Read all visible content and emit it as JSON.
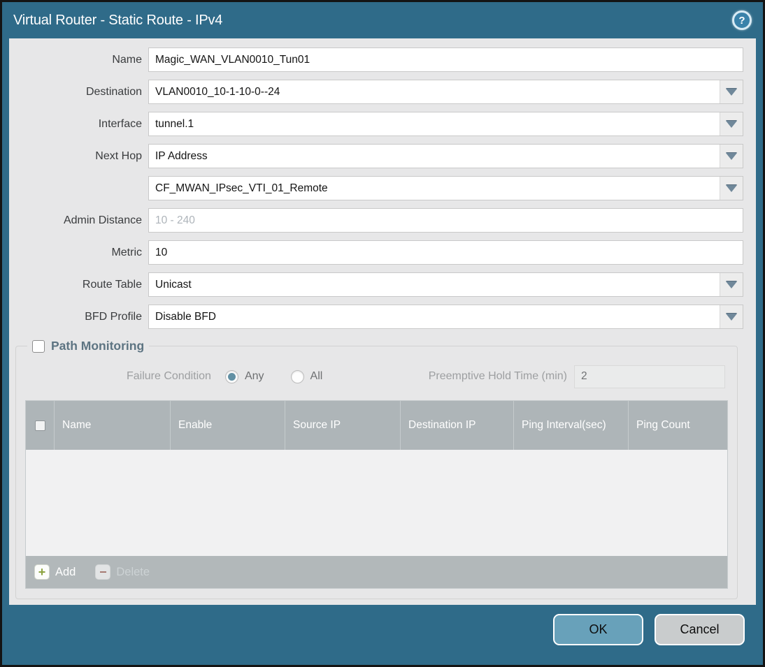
{
  "window": {
    "title": "Virtual Router - Static Route - IPv4",
    "help_glyph": "?"
  },
  "fields": {
    "name": {
      "label": "Name",
      "value": "Magic_WAN_VLAN0010_Tun01"
    },
    "destination": {
      "label": "Destination",
      "value": "VLAN0010_10-1-10-0--24"
    },
    "interface": {
      "label": "Interface",
      "value": "tunnel.1"
    },
    "next_hop": {
      "label": "Next Hop",
      "value": "IP Address"
    },
    "next_hop_address": {
      "value": "CF_MWAN_IPsec_VTI_01_Remote"
    },
    "admin_distance": {
      "label": "Admin Distance",
      "placeholder": "10 - 240",
      "value": ""
    },
    "metric": {
      "label": "Metric",
      "value": "10"
    },
    "route_table": {
      "label": "Route Table",
      "value": "Unicast"
    },
    "bfd_profile": {
      "label": "BFD Profile",
      "value": "Disable BFD"
    }
  },
  "path_monitoring": {
    "title": "Path Monitoring",
    "enabled": false,
    "failure_condition_label": "Failure Condition",
    "options": [
      {
        "label": "Any",
        "selected": true
      },
      {
        "label": "All",
        "selected": false
      }
    ],
    "preemptive_label": "Preemptive Hold Time (min)",
    "preemptive_value": "2",
    "table": {
      "headers": [
        "Name",
        "Enable",
        "Source IP",
        "Destination IP",
        "Ping Interval(sec)",
        "Ping Count"
      ],
      "rows": []
    },
    "add_label": "Add",
    "delete_label": "Delete"
  },
  "footer": {
    "ok_label": "OK",
    "cancel_label": "Cancel"
  },
  "colors": {
    "frame_teal": "#2f6b89",
    "content_bg": "#e7e7e8",
    "table_header_bg": "#aeb5b8",
    "ok_button_bg": "#68a1ba",
    "cancel_button_bg": "#c9cccd",
    "add_icon_green": "#8ba23d",
    "delete_icon_red": "#a57970"
  }
}
